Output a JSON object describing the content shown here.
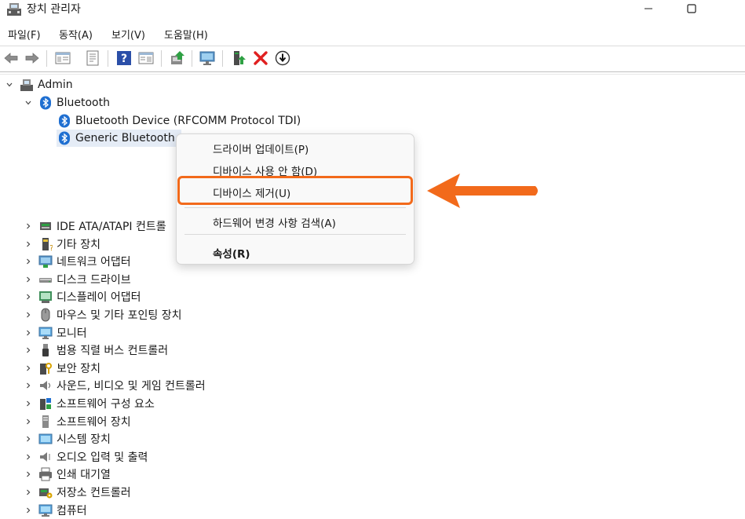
{
  "window": {
    "title": "장치 관리자"
  },
  "menu": [
    "파일(F)",
    "동작(A)",
    "보기(V)",
    "도움말(H)"
  ],
  "toolbar_icons": [
    "back-icon",
    "forward-icon",
    "show-hide-tree-icon",
    "properties-icon",
    "help-icon",
    "view-icon",
    "scan-hardware-icon",
    "monitor-icon",
    "update-driver-icon",
    "uninstall-icon",
    "disable-icon"
  ],
  "tree": {
    "root": "Admin",
    "bluetooth": {
      "label": "Bluetooth",
      "children": [
        "Bluetooth Device (RFCOMM Protocol TDI)",
        "Generic Bluetooth"
      ]
    },
    "categories": [
      {
        "label": "IDE ATA/ATAPI 컨트롤",
        "icon": "ide-controller-icon"
      },
      {
        "label": "기타 장치",
        "icon": "other-device-icon"
      },
      {
        "label": "네트워크 어댑터",
        "icon": "network-adapter-icon"
      },
      {
        "label": "디스크 드라이브",
        "icon": "disk-drive-icon"
      },
      {
        "label": "디스플레이 어댑터",
        "icon": "display-adapter-icon"
      },
      {
        "label": "마우스 및 기타 포인팅 장치",
        "icon": "mouse-icon"
      },
      {
        "label": "모니터",
        "icon": "monitor-icon"
      },
      {
        "label": "범용 직렬 버스 컨트롤러",
        "icon": "usb-icon"
      },
      {
        "label": "보안 장치",
        "icon": "security-device-icon"
      },
      {
        "label": "사운드, 비디오 및 게임 컨트롤러",
        "icon": "speaker-icon"
      },
      {
        "label": "소프트웨어 구성 요소",
        "icon": "software-component-icon"
      },
      {
        "label": "소프트웨어 장치",
        "icon": "software-device-icon"
      },
      {
        "label": "시스템 장치",
        "icon": "system-device-icon"
      },
      {
        "label": "오디오 입력 및 출력",
        "icon": "audio-io-icon"
      },
      {
        "label": "인쇄 대기열",
        "icon": "printer-icon"
      },
      {
        "label": "저장소 컨트롤러",
        "icon": "storage-controller-icon"
      },
      {
        "label": "컴퓨터",
        "icon": "computer-icon"
      }
    ]
  },
  "context_menu": {
    "update_driver": "드라이버 업데이트(P)",
    "disable_device": "디바이스 사용 안 함(D)",
    "uninstall_device": "디바이스 제거(U)",
    "scan_hardware": "하드웨어 변경 사항 검색(A)",
    "properties": "속성(R)"
  },
  "colors": {
    "highlight": "#f26a1b",
    "bluetooth": "#1f6fd1",
    "selection": "#e5ecf6"
  }
}
